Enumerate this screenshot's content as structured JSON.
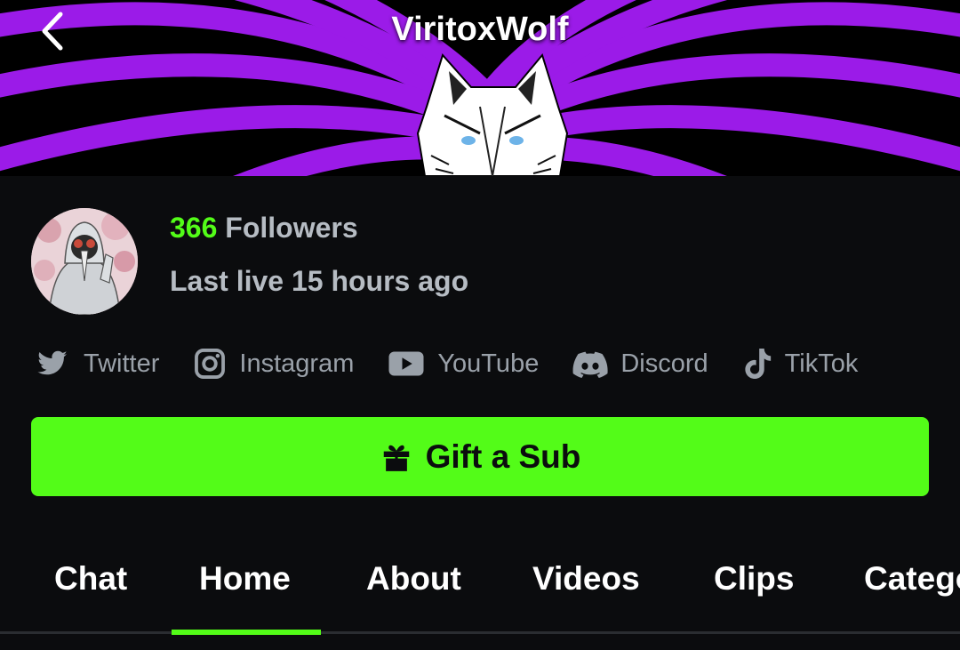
{
  "header": {
    "title": "ViritoxWolf",
    "back_icon": "chevron-left-icon",
    "banner_colors": {
      "purple": "#9b1be8",
      "black": "#000000"
    }
  },
  "profile": {
    "followers_count": "366",
    "followers_label": "Followers",
    "last_live": "Last live 15 hours ago"
  },
  "socials": [
    {
      "label": "Twitter",
      "icon": "twitter-icon"
    },
    {
      "label": "Instagram",
      "icon": "instagram-icon"
    },
    {
      "label": "YouTube",
      "icon": "youtube-icon"
    },
    {
      "label": "Discord",
      "icon": "discord-icon"
    },
    {
      "label": "TikTok",
      "icon": "tiktok-icon"
    }
  ],
  "gift_button": {
    "label": "Gift a Sub",
    "icon": "gift-icon",
    "color": "#53fc18"
  },
  "tabs": [
    {
      "label": "Chat",
      "active": false
    },
    {
      "label": "Home",
      "active": true
    },
    {
      "label": "About",
      "active": false
    },
    {
      "label": "Videos",
      "active": false
    },
    {
      "label": "Clips",
      "active": false
    },
    {
      "label": "Catego",
      "active": false
    }
  ],
  "colors": {
    "accent": "#53fc18",
    "background": "#0b0c0e",
    "muted_text": "#b6bcc3"
  }
}
